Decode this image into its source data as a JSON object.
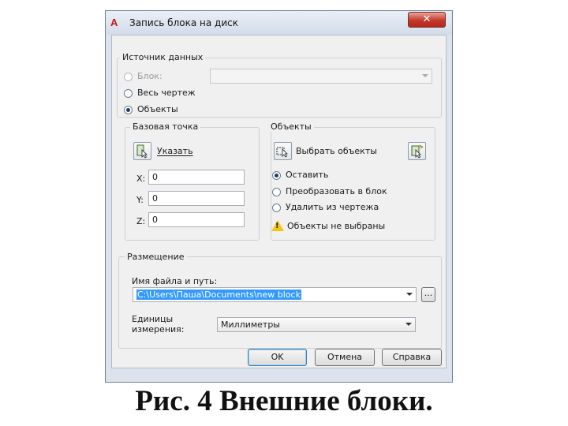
{
  "window": {
    "title": "Запись блока на диск",
    "close_glyph": "✕",
    "app_icon_text": "A"
  },
  "source": {
    "label": "Источник данных",
    "options": [
      {
        "label": "Блок:",
        "selected": false,
        "enabled": false
      },
      {
        "label": "Весь чертеж",
        "selected": false,
        "enabled": true
      },
      {
        "label": "Объекты",
        "selected": true,
        "enabled": true
      }
    ],
    "block_select_value": ""
  },
  "base_point": {
    "label": "Базовая точка",
    "pick_button_label": "Указать",
    "x_label": "X:",
    "x_value": "0",
    "y_label": "Y:",
    "y_value": "0",
    "z_label": "Z:",
    "z_value": "0"
  },
  "objects": {
    "label": "Объекты",
    "select_button_label": "Выбрать объекты",
    "options": [
      {
        "label": "Оставить",
        "selected": true
      },
      {
        "label": "Преобразовать в блок",
        "selected": false
      },
      {
        "label": "Удалить из чертежа",
        "selected": false
      }
    ],
    "warning": "Объекты не выбраны"
  },
  "destination": {
    "label": "Размещение",
    "path_label": "Имя файла и путь:",
    "path_value": "C:\\Users\\Паша\\Documents\\new block",
    "browse_label": "...",
    "units_label_1": "Единицы",
    "units_label_2": "измерения:",
    "units_value": "Миллиметры"
  },
  "buttons": {
    "ok": "OK",
    "cancel": "Отмена",
    "help": "Справка"
  },
  "caption": "Рис. 4 Внешние блоки.",
  "colors": {
    "accent": "#3399ff",
    "close": "#c2392a",
    "warning": "#f5c518"
  }
}
